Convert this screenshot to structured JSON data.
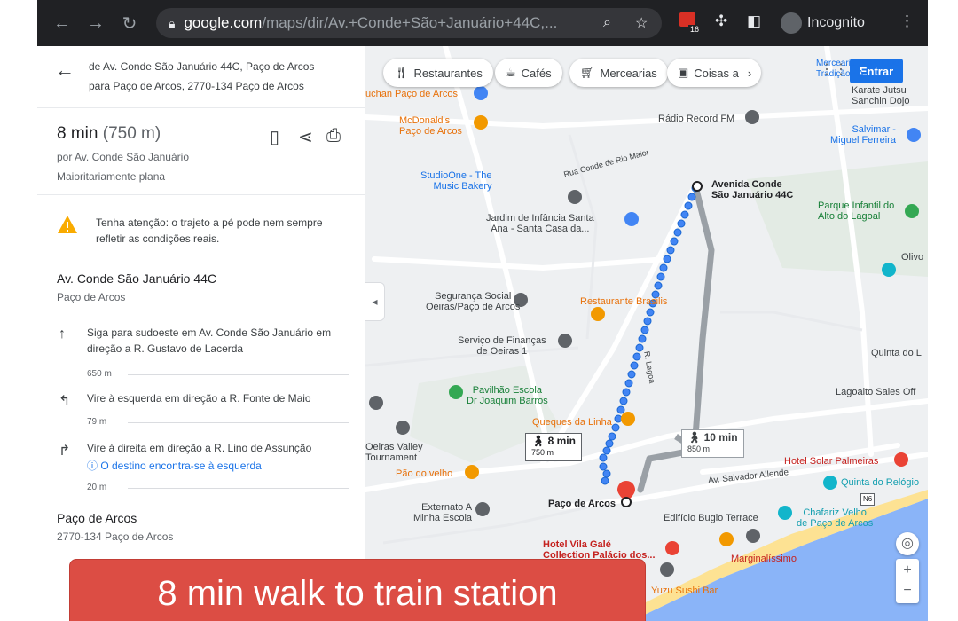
{
  "browser": {
    "url_host": "google.com",
    "url_path": "/maps/dir/Av.+Conde+São+Januário+44C,...",
    "ext_badge": "16",
    "incognito_label": "Incognito"
  },
  "sidebar": {
    "from": "de Av. Conde São Januário 44C, Paço de Arcos",
    "to": "para Paço de Arcos, 2770-134 Paço de Arcos",
    "duration": "8 min",
    "distance": "(750 m)",
    "via": "por Av. Conde São Januário",
    "terrain": "Maioritariamente plana",
    "warning": "Tenha atenção: o trajeto a pé pode nem sempre refletir as condições reais.",
    "start_title": "Av. Conde São Januário 44C",
    "start_sub": "Paço de Arcos",
    "steps": [
      {
        "text": "Siga para sudoeste em Av. Conde São Januário em direção a R. Gustavo de Lacerda",
        "dist": "650 m",
        "icon": "arrow-up-icon"
      },
      {
        "text": "Vire à esquerda em direção a R. Fonte de Maio",
        "dist": "79 m",
        "icon": "turn-left-icon"
      },
      {
        "text": "Vire à direita em direção a R. Lino de Assunção",
        "info": "O destino encontra-se à esquerda",
        "dist": "20 m",
        "icon": "turn-right-icon"
      }
    ],
    "end_title": "Paço de Arcos",
    "end_sub": "2770-134 Paço de Arcos"
  },
  "map": {
    "chips": [
      "Restaurantes",
      "Cafés",
      "Mercearias",
      "Coisas a"
    ],
    "signin": "Entrar",
    "route_primary": {
      "time": "8 min",
      "dist": "750 m"
    },
    "route_alt": {
      "time": "10 min",
      "dist": "850 m"
    },
    "start_label": "Avenida Conde\nSão Januário 44C",
    "end_label": "Paço de Arcos",
    "labels": {
      "l1": "Mercearia de Parque\nTradição - A...",
      "l2": "Karate Jutsu\nSanchin Dojo",
      "l3": "Rádio Record FM",
      "l4": "Salvimar -\nMiguel Ferreira",
      "l5": "McDonald's\nPaço de Arcos",
      "l6": "uchan Paço de Arcos",
      "l7": "Rua Conde de Rio Maior",
      "l8": "StudioOne - The\nMusic Bakery",
      "l9": "Jardim de Infância Santa\nAna - Santa Casa da...",
      "l10": "Parque Infantil do\nAlto do Lagoal",
      "l11": "Olivo",
      "l12": "Segurança Social\nOeiras/Paço de Arcos",
      "l13": "Restaurante Brasilis",
      "l14": "Serviço de Finanças\nde Oeiras 1",
      "l15": "R. Lagoa",
      "l16": "Quinta do L",
      "l17": "Pavilhão Escola\nDr Joaquim Barros",
      "l18": "Lagoalto Sales Off",
      "l19": "Queques da Linha",
      "l20": "Oeiras Valley\nTournament",
      "l21": "Pão do velho",
      "l22": "Hotel Solar Palmeiras",
      "l23": "Av. Salvador Allende",
      "l24": "Quinta do Relógio",
      "l25": "Externato A\nMinha Escola",
      "l26": "Edifício Bugio Terrace",
      "l27": "Chafariz Velho\nde Paço de Arcos",
      "l28": "Hotel Vila Galé\nCollection Palácio dos...",
      "l29": "Marginalíssimo",
      "l30": "Yuzu Sushi Bar",
      "l31": "N6"
    }
  },
  "banner": "8 min walk to train station",
  "colors": {
    "route": "#4285f4",
    "alt_route": "#9aa0a6",
    "banner": "#dc4d44"
  }
}
